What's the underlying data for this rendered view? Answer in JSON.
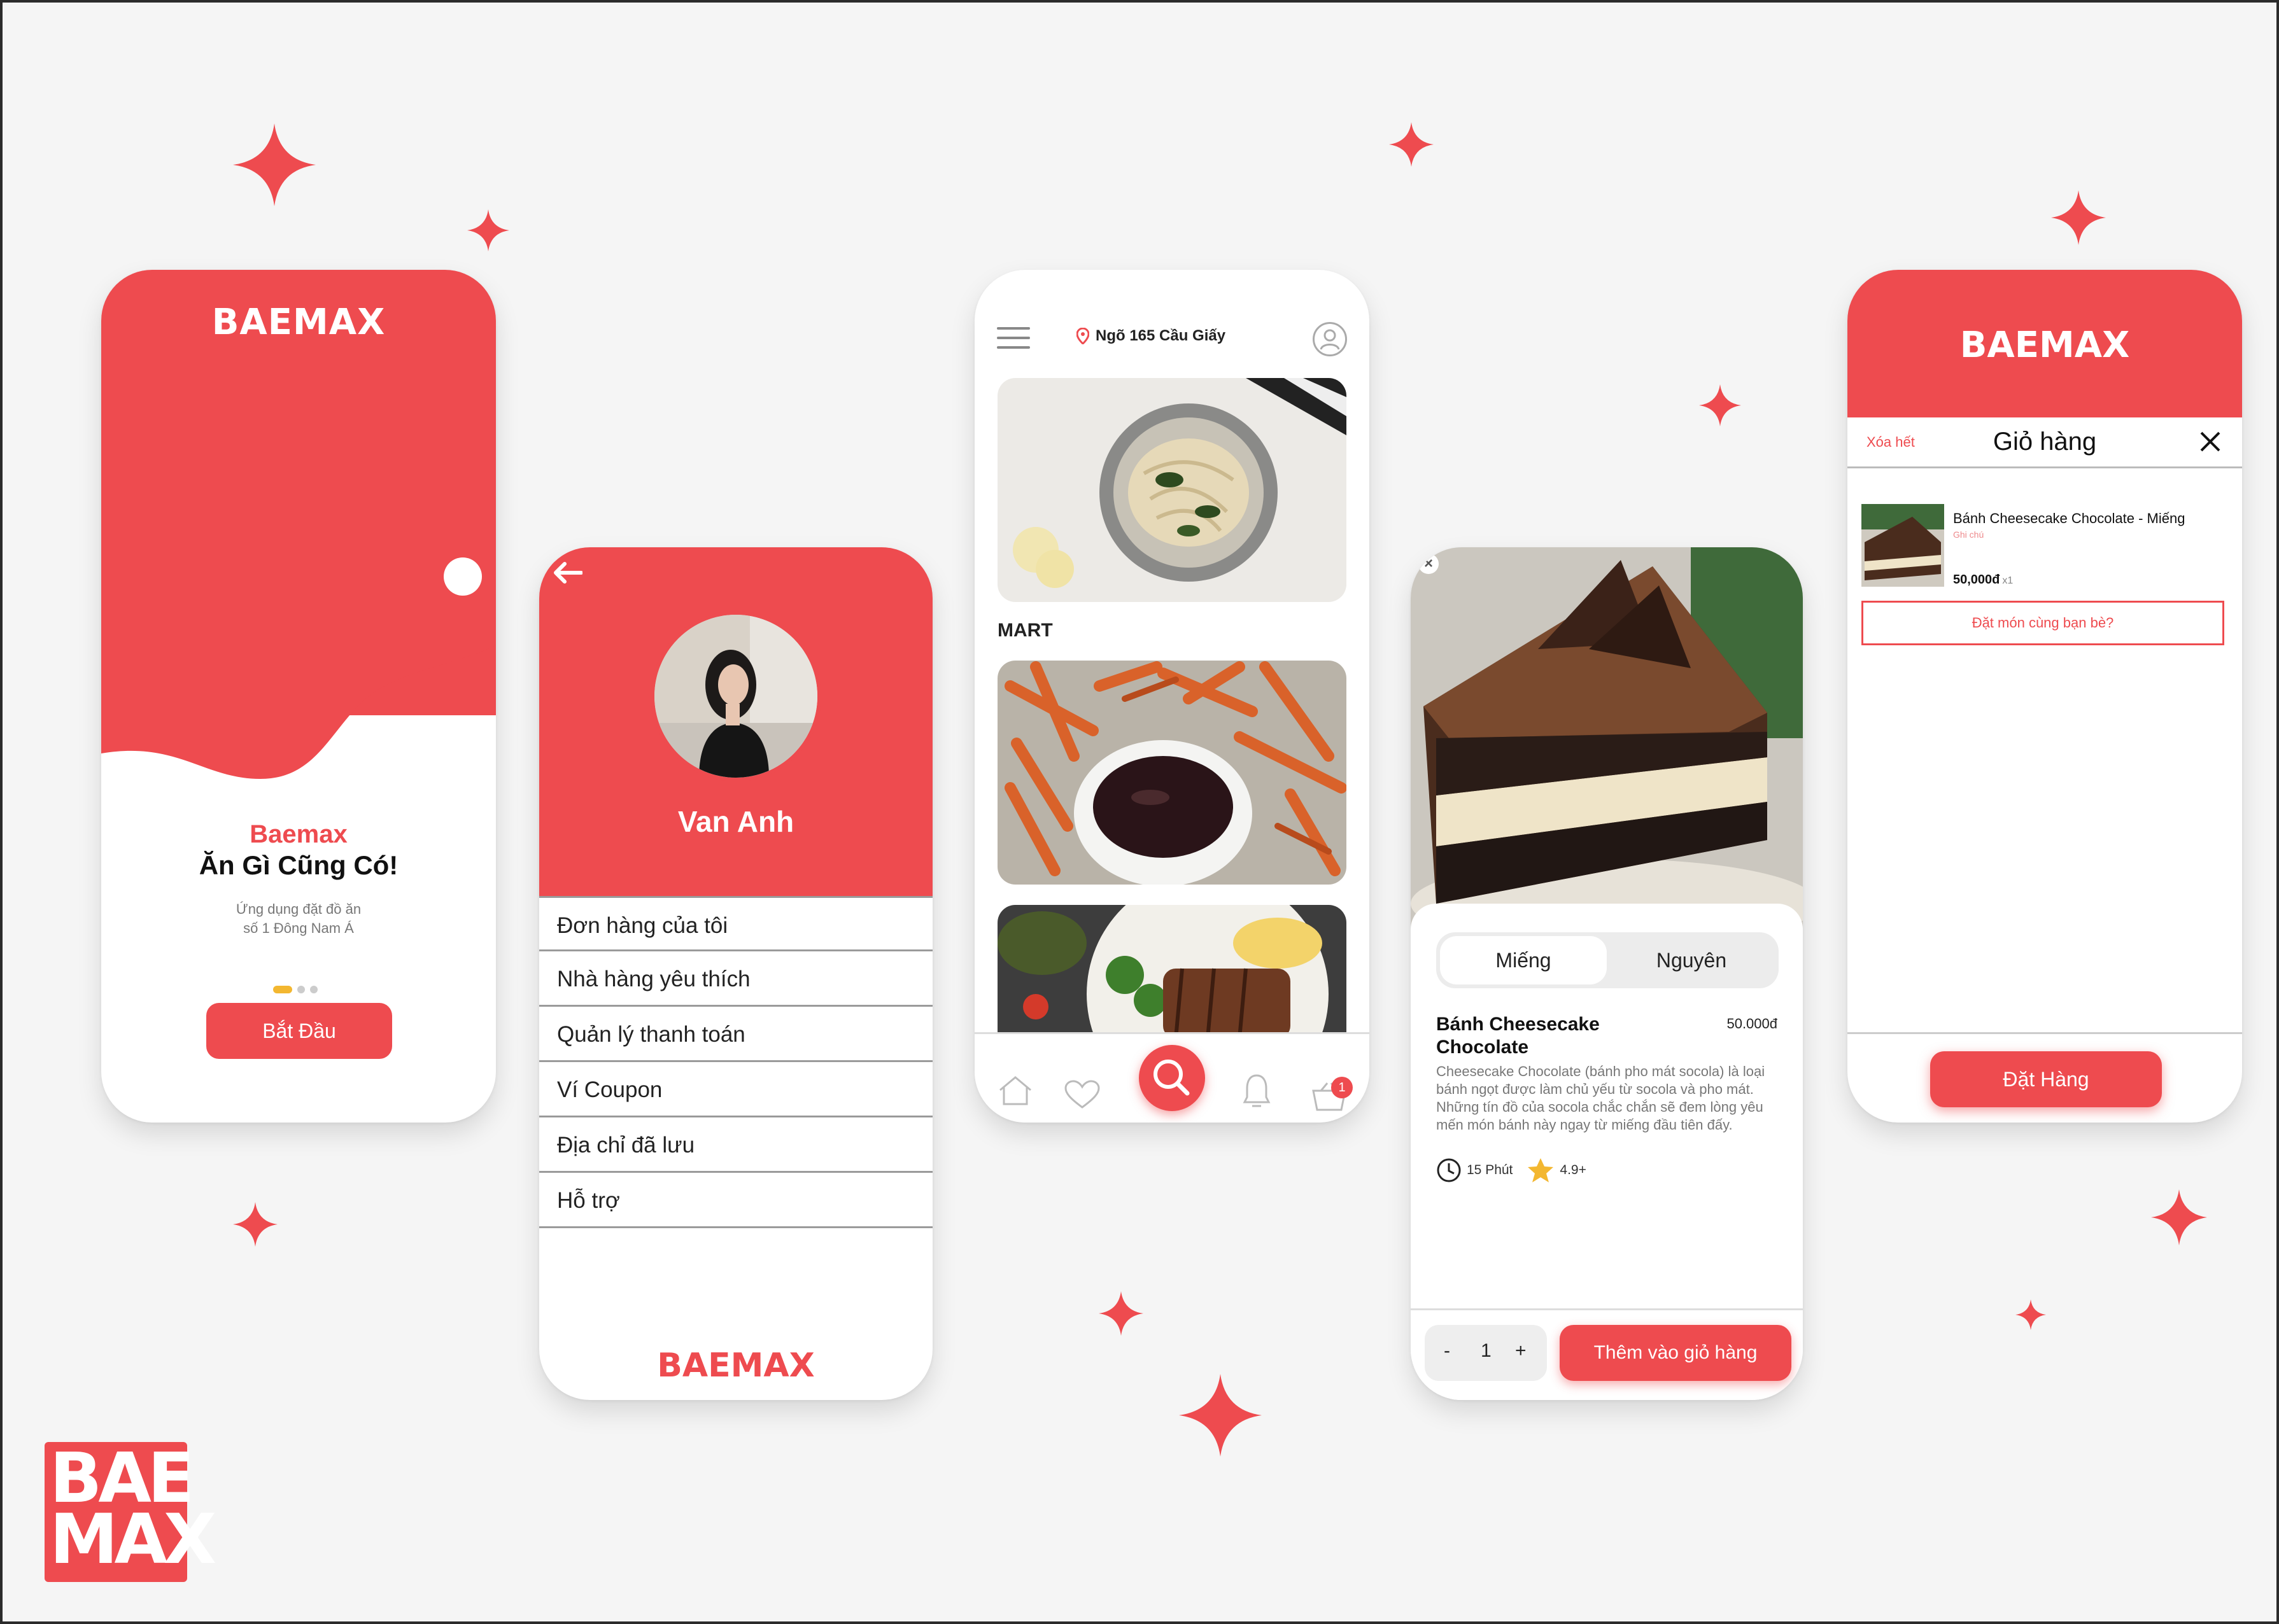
{
  "colors": {
    "brand": "#ee4b4f",
    "accent_yellow": "#f3b730",
    "text": "#111111",
    "muted": "#777777"
  },
  "brand": "BAEMAX",
  "welcome": {
    "logo": "BAEMAX",
    "title_brand": "Baemax",
    "title": "Ăn Gì Cũng Có!",
    "subtitle_line1": "Ứng dụng đặt đồ ăn",
    "subtitle_line2": "số 1 Đông Nam Á",
    "start_button": "Bắt Đầu"
  },
  "profile": {
    "back_icon": "arrow-left-icon",
    "name": "Van Anh",
    "menu": [
      "Đơn hàng của tôi",
      "Nhà hàng yêu thích",
      "Quản lý thanh toán",
      "Ví Coupon",
      "Địa chỉ đã lưu",
      "Hỗ trợ"
    ],
    "footer_logo": "BAEMAX"
  },
  "home": {
    "location": "Ngõ 165 Cầu Giấy",
    "section_label": "MART",
    "cart_badge": "1",
    "nav_icons": [
      "home-icon",
      "heart-icon",
      "search-icon",
      "bell-icon",
      "basket-icon"
    ]
  },
  "product": {
    "tabs": [
      "Miếng",
      "Nguyên"
    ],
    "name": "Bánh Cheesecake Chocolate",
    "price": "50.000đ",
    "description": "Cheesecake Chocolate (bánh pho mát socola) là loại bánh ngọt được làm chủ yếu từ socola và pho mát. Những tín đồ của socola chắc chắn sẽ đem lòng yêu mến món bánh này ngay từ miếng đầu tiên đấy.",
    "time": "15 Phút",
    "rating": "4.9+",
    "qty_minus": "-",
    "qty_value": "1",
    "qty_plus": "+",
    "add_button": "Thêm vào giỏ hàng"
  },
  "cart": {
    "logo": "BAEMAX",
    "clear_label": "Xóa hết",
    "title": "Giỏ hàng",
    "item_name": "Bánh Cheesecake Chocolate - Miếng",
    "item_note": "Ghi chú",
    "item_price": "50,000đ",
    "item_qty": "x1",
    "share_button": "Đặt món cùng bạn bè?",
    "order_button": "Đặt Hàng"
  },
  "corner_logo": {
    "line1": "BAE",
    "line2": "MAX"
  }
}
